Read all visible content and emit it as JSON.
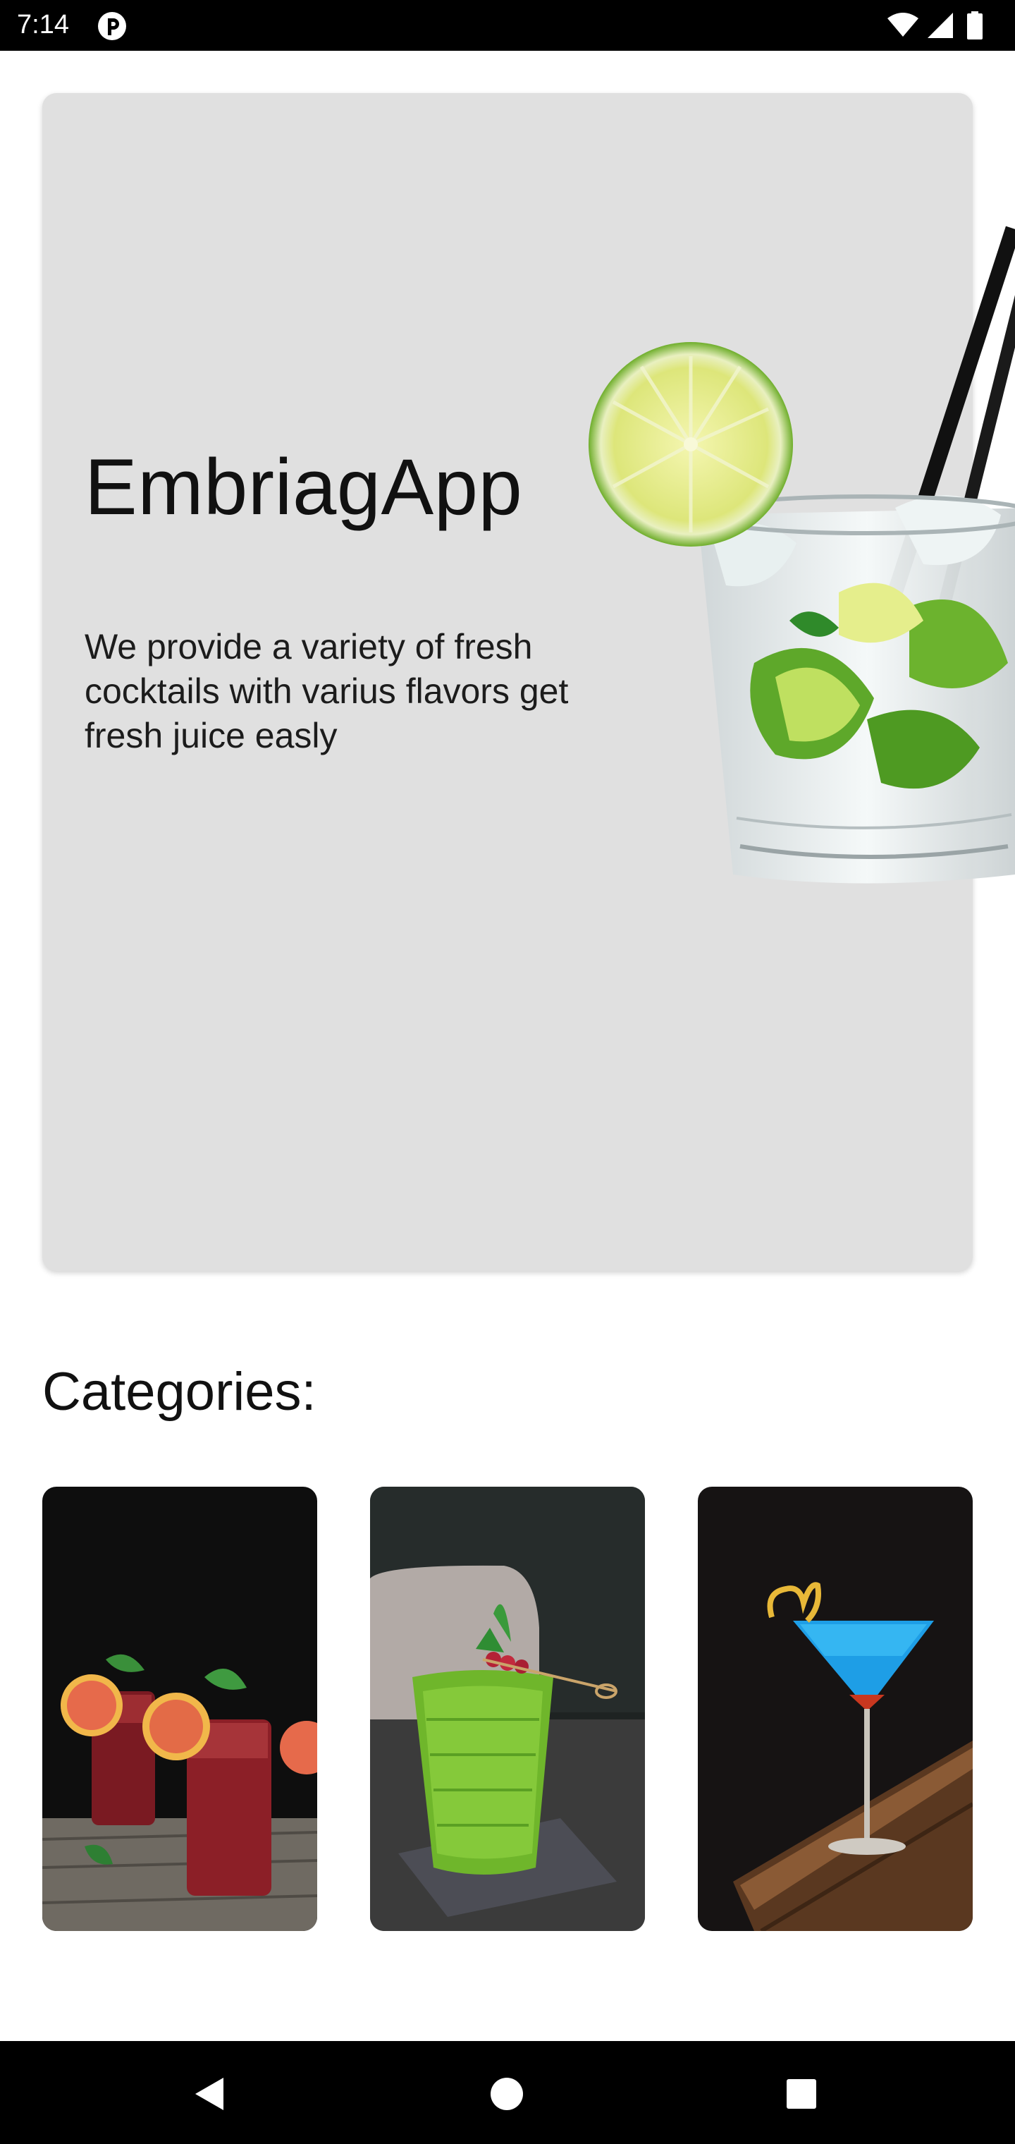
{
  "status_bar": {
    "time": "7:14",
    "icons": [
      "app-notification-icon",
      "wifi-icon",
      "signal-icon",
      "battery-icon"
    ]
  },
  "hero": {
    "title": "EmbriagApp",
    "description": "We provide a variety of fresh cocktails with varius flavors get fresh juice easly",
    "image": "lime-cocktail-glass-image",
    "background_color": "#e0e0e0"
  },
  "categories": {
    "title": "Categories:",
    "items": [
      {
        "image": "red-fruit-cocktails-image"
      },
      {
        "image": "green-cocktail-image"
      },
      {
        "image": "blue-martini-image"
      }
    ]
  },
  "nav_bar": {
    "icons": [
      "back-icon",
      "home-icon",
      "recents-icon"
    ]
  }
}
